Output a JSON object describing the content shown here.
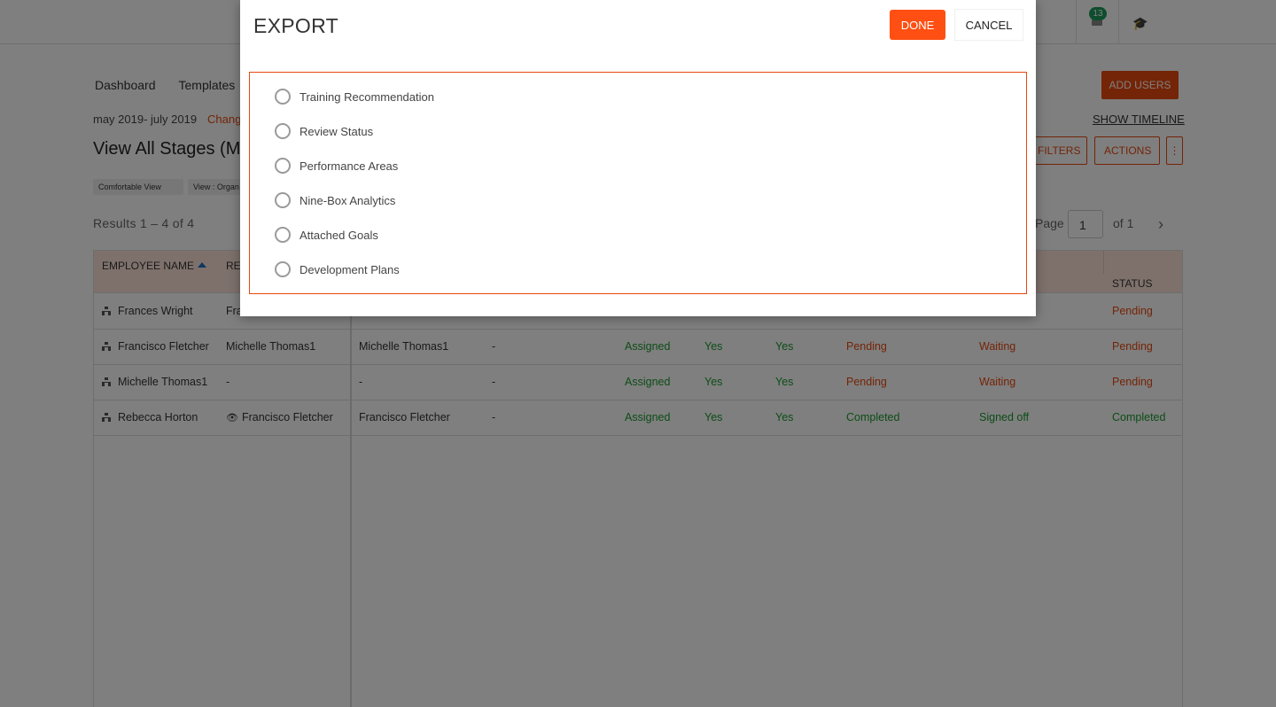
{
  "topbar": {
    "notification_count": "13",
    "cap_icon": "graduation-cap-icon",
    "bell_icon": "bell-icon"
  },
  "nav": {
    "items": [
      "Dashboard",
      "Templates"
    ]
  },
  "toolbar": {
    "add_users_label": "ADD USERS",
    "period": "may 2019- july 2019",
    "change_label": "Chang",
    "show_timeline_label": "SHOW TIMELINE",
    "title": "View All Stages (May",
    "filters_label": "FILTERS",
    "actions_label": "ACTIONS",
    "more_label": "⋮",
    "view_chip": "Comfortable View",
    "org_chip": "View : Organ"
  },
  "results": {
    "text": "Results 1 – 4 of 4",
    "page_label": "Page",
    "page_value": "1",
    "of_label": "of 1"
  },
  "table": {
    "headers": {
      "employee": "EMPLOYEE NAME",
      "reviewer": "RE",
      "status": "STATUS"
    },
    "rows": [
      {
        "employee": "Frances Wright",
        "reviewer": "Fra",
        "manager": "",
        "c1": "",
        "c2": "",
        "c3": "",
        "c4": "",
        "c5": "",
        "c6": "",
        "status": "Pending"
      },
      {
        "employee": "Francisco Fletcher",
        "reviewer": "Michelle Thomas1",
        "manager": "Michelle Thomas1",
        "c1": "-",
        "c2": "Assigned",
        "c3": "Yes",
        "c4": "Yes",
        "c5": "Pending",
        "c6": "Waiting",
        "status": "Pending"
      },
      {
        "employee": "Michelle Thomas1",
        "reviewer": "-",
        "manager": "-",
        "c1": "-",
        "c2": "Assigned",
        "c3": "Yes",
        "c4": "Yes",
        "c5": "Pending",
        "c6": "Waiting",
        "status": "Pending"
      },
      {
        "employee": "Rebecca Horton",
        "reviewer": "Francisco Fletcher",
        "manager": "Francisco Fletcher",
        "c1": "-",
        "c2": "Assigned",
        "c3": "Yes",
        "c4": "Yes",
        "c5": "Completed",
        "c6": "Signed off",
        "status": "Completed"
      }
    ]
  },
  "modal": {
    "title": "EXPORT",
    "done_label": "DONE",
    "cancel_label": "CANCEL",
    "options": [
      "Training Recommendation",
      "Review Status",
      "Performance Areas",
      "Nine-Box Analytics",
      "Attached Goals",
      "Development Plans"
    ]
  },
  "colors": {
    "accent": "#e8480e",
    "done": "#ff4f12",
    "success": "#1a9a2e",
    "header_bg": "#fde3d8"
  }
}
